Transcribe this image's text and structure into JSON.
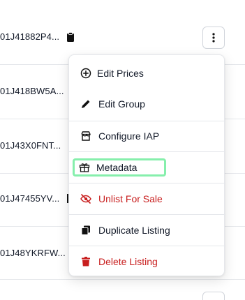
{
  "rows": [
    {
      "id_text": "01J41882P4...",
      "has_clipboard": true
    },
    {
      "id_text": "01J418BW5A...",
      "has_clipboard": false
    },
    {
      "id_text": "01J43X0FNT...",
      "has_clipboard": false
    },
    {
      "id_text": "01J47455YV...",
      "has_clipboard": true
    },
    {
      "id_text": "01J48YKRFW...",
      "has_clipboard": false
    }
  ],
  "row_menu_button": {
    "icon": "vertical-ellipsis-icon"
  },
  "menu": {
    "items": [
      {
        "label": "Edit Prices",
        "icon": "plus-circle-icon",
        "color": "#111827"
      },
      {
        "label": "Edit Group",
        "icon": "pencil-icon",
        "color": "#111827"
      },
      {
        "label": "Configure IAP",
        "icon": "store-icon",
        "color": "#111827"
      },
      {
        "label": "Metadata",
        "icon": "gift-icon",
        "color": "#111827",
        "focused": true
      },
      {
        "label": "Unlist For Sale",
        "icon": "eye-slash-icon",
        "color": "#c81e1e"
      },
      {
        "label": "Duplicate Listing",
        "icon": "copy-icon",
        "color": "#111827"
      },
      {
        "label": "Delete Listing",
        "icon": "trash-icon",
        "color": "#c81e1e"
      }
    ],
    "focus_color": "#86efac"
  }
}
